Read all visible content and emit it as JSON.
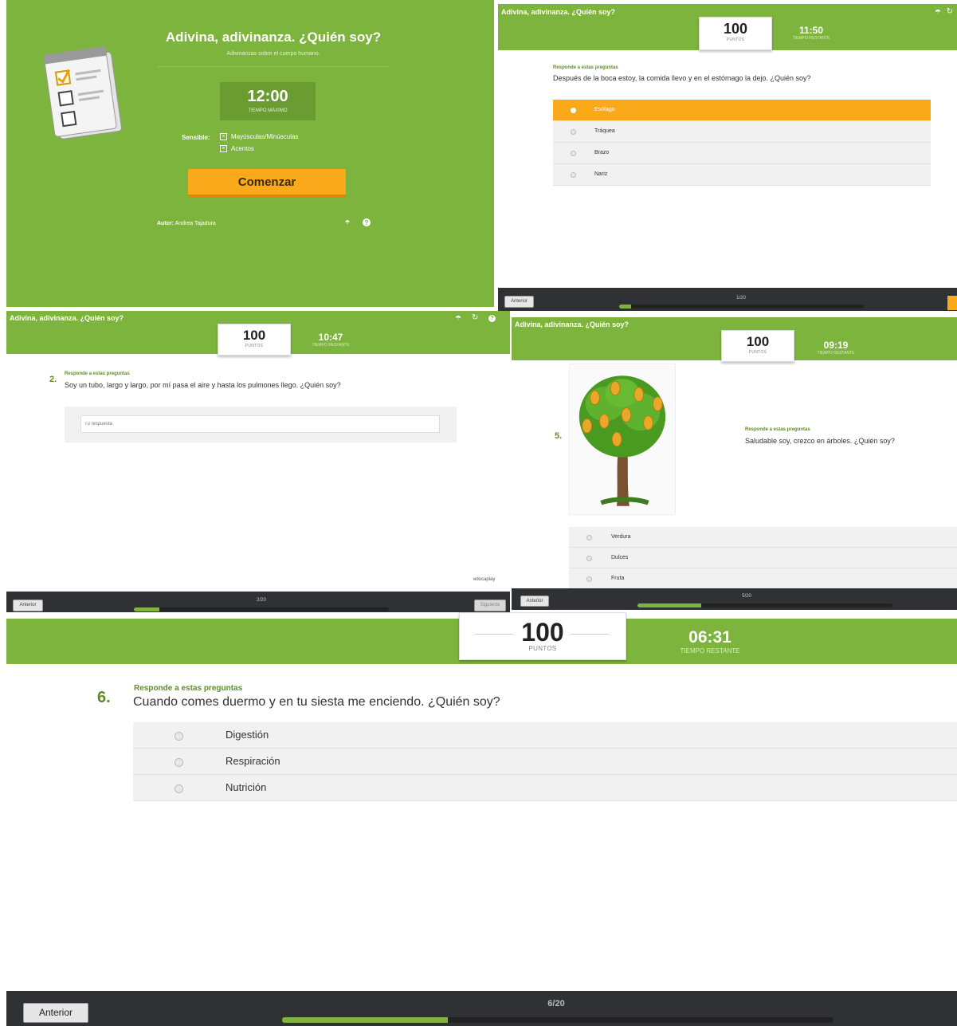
{
  "quiz_title": "Adivina, adivinanza. ¿Quién soy?",
  "intro": {
    "title": "Adivina, adivinanza. ¿Quién soy?",
    "subtitle": "Adivinanzas sobre el cuerpo humano.",
    "time": "12:00",
    "time_label": "TIEMPO MÁXIMO",
    "sensible_label": "Sensible:",
    "options": [
      "Mayúsculas/Minúsculas",
      "Acentos"
    ],
    "start_button": "Comenzar",
    "author_label": "Autor:",
    "author_name": "Andrea Tajadura"
  },
  "common": {
    "points": "100",
    "points_label": "PUNTOS",
    "time_remaining_label": "TIEMPO RESTANTE",
    "question_prompt": "Responde a estas preguntas",
    "prev_button": "Anterior",
    "next_button": "Siguiente",
    "brand": "educaplay"
  },
  "q1": {
    "timer": "11:50",
    "question": "Después de la boca estoy, la comida llevo y en el estómago la dejo. ¿Quién soy?",
    "options": [
      "Esófago",
      "Tráquea",
      "Brazo",
      "Nariz"
    ],
    "selected_index": 0,
    "progress_text": "1/20",
    "progress": 0.05
  },
  "q2": {
    "number": "2.",
    "timer": "10:47",
    "question": "Soy un tubo, largo y largo, por mí pasa el aire y hasta los pulmones llego. ¿Quién soy?",
    "input_placeholder": "Tu respuesta",
    "progress_text": "2/20",
    "progress": 0.1
  },
  "q5": {
    "number": "5.",
    "timer": "09:19",
    "question": "Saludable soy, crezco en árboles. ¿Quién soy?",
    "options": [
      "Verdura",
      "Dulces",
      "Fruta"
    ],
    "progress_text": "5/20",
    "progress": 0.25
  },
  "q6": {
    "number": "6.",
    "timer": "06:31",
    "question": "Cuando comes duermo y en tu siesta me enciendo. ¿Quién soy?",
    "options": [
      "Digestión",
      "Respiración",
      "Nutrición"
    ],
    "progress_text": "6/20",
    "progress": 0.3
  },
  "colors": {
    "green": "#7db43d",
    "orange": "#f9a91a",
    "dark": "#2f3134"
  }
}
